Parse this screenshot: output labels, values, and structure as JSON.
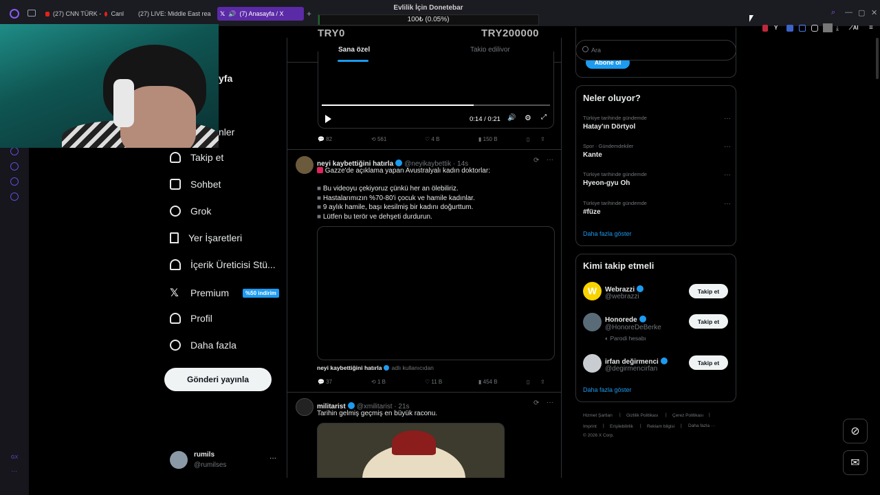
{
  "browser": {
    "tabs": [
      {
        "label": "(27) CNN TÜRK - ",
        "suffix": "Canl"
      },
      {
        "label": "(27) LIVE: Middle East real"
      },
      {
        "label": "(7) Anasayfa / X"
      }
    ],
    "tab_plus": "+"
  },
  "donation": {
    "title": "Evlilik İçin Donetebar",
    "progress_text": "100₺ (0.05%)",
    "progress_fraction": 0.0005,
    "min_label": "TRY0",
    "max_label": "TRY200000"
  },
  "nav": {
    "partial_home": "yfa",
    "partial_notifications": "nler",
    "items": [
      {
        "label": "Takip et",
        "icon": "person-plus-icon"
      },
      {
        "label": "Sohbet",
        "icon": "envelope-icon"
      },
      {
        "label": "Grok",
        "icon": "grok-icon"
      },
      {
        "label": "Yer İşaretleri",
        "icon": "bookmark-icon"
      },
      {
        "label": "İçerik Üreticisi Stü...",
        "icon": "creator-studio-icon"
      },
      {
        "label": "Premium",
        "icon": "x-logo-icon"
      },
      {
        "label": "Profil",
        "icon": "person-icon"
      },
      {
        "label": "Daha fazla",
        "icon": "more-circle-icon"
      }
    ],
    "premium_badge": "%50 indirim",
    "post_button": "Gönderi yayınla",
    "account_name": "rumils",
    "account_handle": "@rumilses",
    "account_more": "···"
  },
  "feed": {
    "tabs": [
      "Sana özel",
      "Takip ediliyor"
    ],
    "video": {
      "time": "0:14 / 0:21",
      "progress": 0.667
    },
    "tweet0_actions": {
      "replies": "82",
      "retweets": "561",
      "likes": "4 B",
      "views": "150 B"
    },
    "tweet1": {
      "name": "neyi kaybettiğini hatırla",
      "handle": "@neyikaybettik · 14s",
      "text": "Gazze'de açıklama yapan Avustralyalı kadın doktorlar:",
      "bullets": [
        "Bu videoyu çekiyoruz çünkü her an ölebiliriz.",
        "Hastalarımızın %70-80'i çocuk ve hamile kadınlar.",
        "9 aylık hamile, başı kesilmiş bir kadını doğurttum.",
        "Lütfen bu terör ve dehşeti durdurun."
      ],
      "byline_name": "neyi kaybettiğini hatırla",
      "byline_suffix": "adlı kullanıcıdan",
      "replies": "37",
      "retweets": "1 B",
      "likes": "11 B",
      "views": "454 B"
    },
    "tweet2": {
      "name": "militarist",
      "handle": "@xmilitarist · 21s",
      "text": "Tarihin gelmiş geçmiş en büyük raconu."
    }
  },
  "right": {
    "search_placeholder": "Ara",
    "subscribe_partial": "Abone ol",
    "trends_title": "Neler oluyor?",
    "trends": [
      {
        "category": "Türkiye tarihinde gündemde",
        "name": "Hatay'ın Dörtyol"
      },
      {
        "category": "Spor · Gündemdekiler",
        "name": "Kante"
      },
      {
        "category": "Türkiye tarihinde gündemde",
        "name": "Hyeon-gyu Oh"
      },
      {
        "category": "Türkiye tarihinde gündemde",
        "name": "#füze"
      }
    ],
    "trends_more": "Daha fazla göster",
    "who_title": "Kimi takip etmeli",
    "who": [
      {
        "name": "Webrazzi",
        "handle": "@webrazzi",
        "button": "Takip et"
      },
      {
        "name": "Honorede",
        "handle": "@HonoreDeBerke",
        "note": "Parodi hesabı",
        "button": "Takip et"
      },
      {
        "name": "irfan değirmenci",
        "handle": "@degirmencirfan",
        "button": "Takip et"
      }
    ],
    "who_more": "Daha fazla göster",
    "footer": [
      "Hizmet Şartları",
      "Gizlilik Politikası",
      "Çerez Politikası",
      "Imprint",
      "Erişilebilirlik",
      "Reklam bilgisi",
      "Daha fazla ···",
      "© 2026 X Corp."
    ]
  },
  "toolbar": {
    "ai_label": "AI"
  },
  "sidebar_label": "GX"
}
